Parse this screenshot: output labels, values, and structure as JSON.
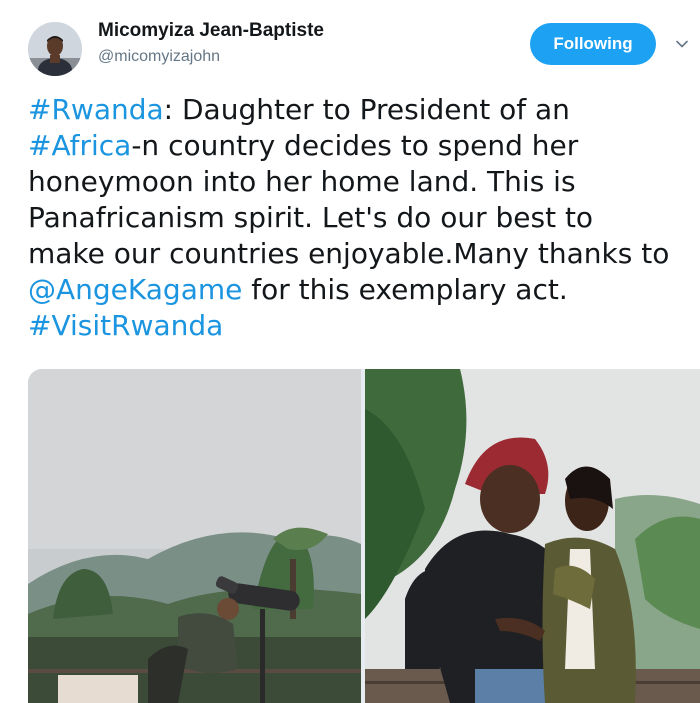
{
  "author": {
    "name": "Micomyiza Jean-Baptiste",
    "handle": "@micomyizajohn"
  },
  "follow_button": {
    "label": "Following",
    "state": "following"
  },
  "tweet_lines": [
    [
      {
        "text": "#Rwanda",
        "link": true
      },
      {
        "text": ": Daughter to President of an",
        "link": false
      }
    ],
    [
      {
        "text": "#Africa",
        "link": true
      },
      {
        "text": "-n country decides to spend her",
        "link": false
      }
    ],
    [
      {
        "text": "honeymoon into her home land. This is",
        "link": false
      }
    ],
    [
      {
        "text": "Panafricanism spirit. Let's do our best to",
        "link": false
      }
    ],
    [
      {
        "text": "make our countries enjoyable.Many thanks to",
        "link": false
      }
    ],
    [
      {
        "text": "@AngeKagame",
        "link": true
      },
      {
        "text": " for this exemplary act.",
        "link": false
      }
    ],
    [
      {
        "text": "#VisitRwanda",
        "link": true
      }
    ]
  ],
  "colors": {
    "link": "#1b95e0",
    "text": "#14171a",
    "secondary": "#657786",
    "button": "#1da1f2"
  },
  "icons": {
    "menu": "chevron-down-icon",
    "avatar": "profile-photo"
  },
  "media": {
    "count": 2,
    "photos": [
      "spotting-scope-garden-photo",
      "couple-outdoor-photo"
    ]
  }
}
